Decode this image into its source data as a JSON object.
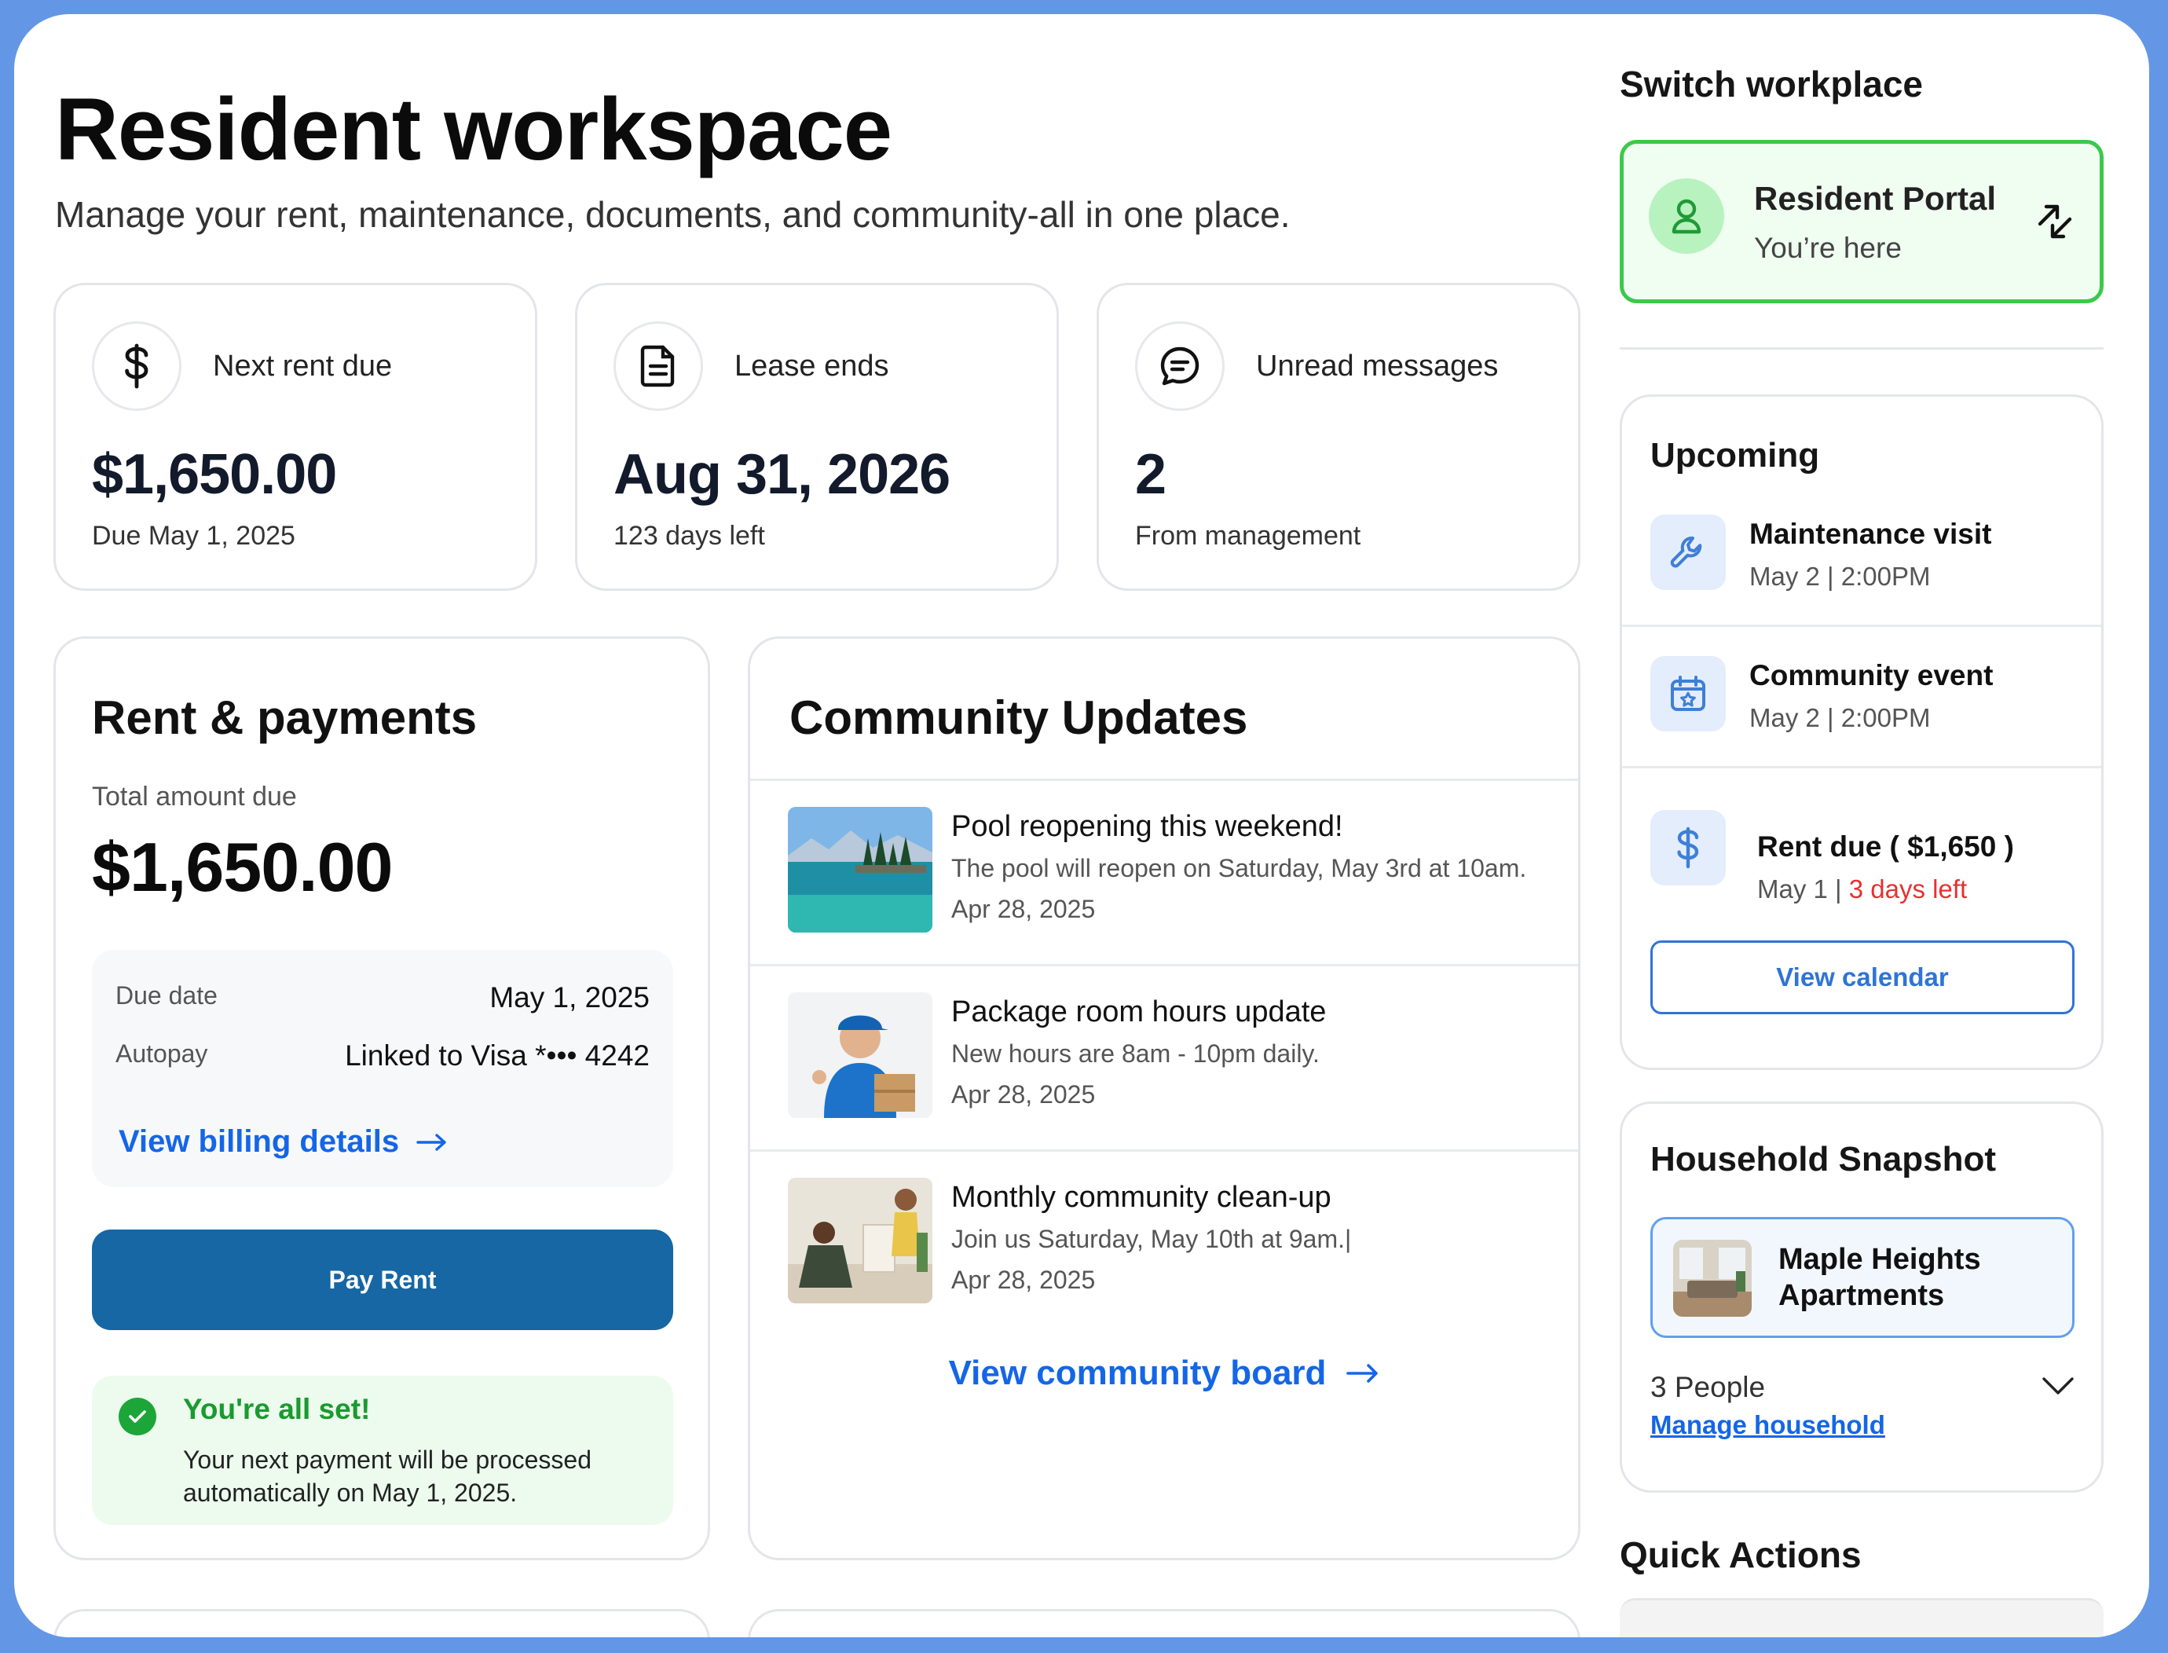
{
  "header": {
    "title": "Resident workspace",
    "subtitle": "Manage your rent, maintenance, documents, and community-all in one place."
  },
  "stats": [
    {
      "icon": "dollar-icon",
      "label": "Next rent due",
      "value": "$1,650.00",
      "sub": "Due May 1, 2025"
    },
    {
      "icon": "document-icon",
      "label": "Lease ends",
      "value": "Aug 31, 2026",
      "sub": "123 days left"
    },
    {
      "icon": "message-icon",
      "label": "Unread messages",
      "value": "2",
      "sub": "From management"
    }
  ],
  "rent": {
    "title": "Rent & payments",
    "total_label": "Total amount due",
    "total_value": "$1,650.00",
    "due_date_label": "Due date",
    "due_date_value": "May 1, 2025",
    "autopay_label": "Autopay",
    "autopay_value": "Linked to Visa *••• 4242",
    "billing_link": "View billing details",
    "pay_button": "Pay Rent",
    "success_title": "You're all set!",
    "success_text": "Your next payment will be processed automatically on May 1, 2025."
  },
  "community": {
    "title": "Community Updates",
    "items": [
      {
        "title": "Pool reopening this weekend!",
        "desc": "The pool will reopen on Saturday, May 3rd at 10am.",
        "date": "Apr 28, 2025"
      },
      {
        "title": "Package room hours update",
        "desc": "New hours are 8am - 10pm daily.",
        "date": "Apr 28, 2025"
      },
      {
        "title": "Monthly community clean-up",
        "desc": "Join us Saturday, May 10th at 9am.|",
        "date": "Apr 28, 2025"
      }
    ],
    "board_link": "View community board"
  },
  "workplace": {
    "heading": "Switch workplace",
    "name": "Resident Portal",
    "status": "You’re here"
  },
  "upcoming": {
    "title": "Upcoming",
    "items": [
      {
        "icon": "wrench-icon",
        "title": "Maintenance visit",
        "sub": "May 2 | 2:00PM"
      },
      {
        "icon": "calendar-star-icon",
        "title": "Community event",
        "sub": "May 2 | 2:00PM"
      },
      {
        "icon": "dollar-icon",
        "title": "Rent due ( $1,650 )",
        "sub_prefix": "May 1 | ",
        "sub_alert": "3 days left"
      }
    ],
    "calendar_button": "View calendar"
  },
  "household": {
    "title": "Household Snapshot",
    "property": "Maple Heights Apartments",
    "people": "3 People",
    "manage_link": "Manage household"
  },
  "quick_actions": {
    "title": "Quick Actions"
  },
  "colors": {
    "frame": "#6496e6",
    "primary_button": "#1667a3",
    "link": "#1466e6",
    "success": "#1a9a2f",
    "alert": "#e53131",
    "active_border": "#3cc84b"
  }
}
